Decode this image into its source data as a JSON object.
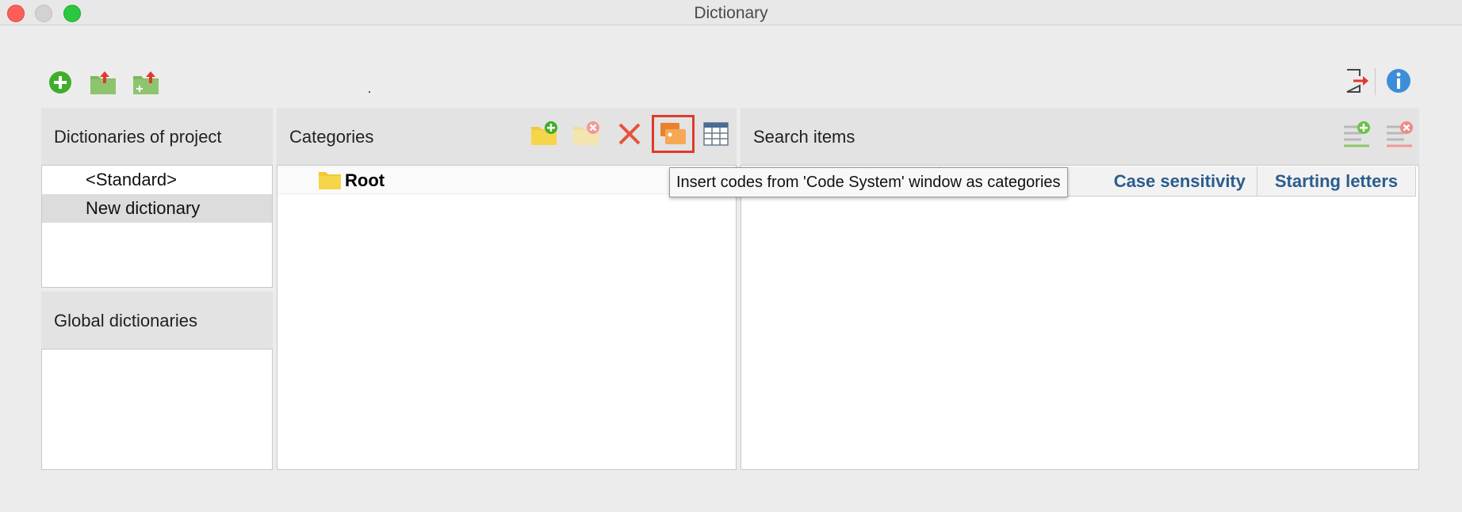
{
  "window": {
    "title": "Dictionary"
  },
  "toolbar": {
    "left_icons": [
      "add-circle-icon",
      "import-folder-icon",
      "import-folder-add-icon"
    ],
    "right_icons": [
      "exit-icon",
      "info-icon"
    ]
  },
  "dictionaries_panel": {
    "title": "Dictionaries of project",
    "items": [
      {
        "label": "<Standard>",
        "selected": false
      },
      {
        "label": "New dictionary",
        "selected": true
      }
    ]
  },
  "global_panel": {
    "title": "Global dictionaries",
    "items": []
  },
  "categories_panel": {
    "title": "Categories",
    "toolbar": [
      "new-category-icon",
      "delete-category-icon",
      "delete-icon",
      "insert-codes-icon",
      "table-icon"
    ],
    "tree": [
      {
        "label": "Root",
        "icon": "folder-icon"
      }
    ]
  },
  "search_panel": {
    "title": "Search items",
    "toolbar": [
      "add-search-item-icon",
      "remove-search-item-icon"
    ],
    "columns": [
      "Case sensitivity",
      "Starting letters"
    ]
  },
  "tooltip": {
    "text": "Insert codes from 'Code System' window as categories"
  },
  "colors": {
    "accent_blue": "#2a5d8f",
    "highlight_red": "#e03a2a",
    "folder_yellow": "#f7d54a"
  }
}
